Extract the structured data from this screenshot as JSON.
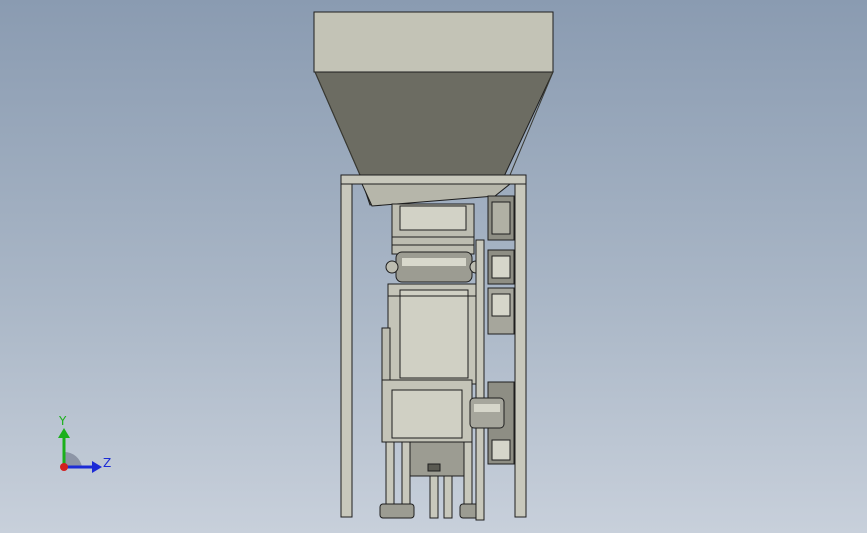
{
  "viewport": {
    "background_top": "#8a9bb1",
    "background_bottom": "#c8d0db"
  },
  "model": {
    "hopper_top_color": "#c3c3b6",
    "hopper_front_color": "#6c6c62",
    "frame_color": "#c8c8bc",
    "edge_color": "#1e1e1e"
  },
  "triad": {
    "y_label": "Y",
    "z_label": "Z",
    "y_color": "#1bb01b",
    "z_color": "#1c2bd6",
    "x_color": "#d21f1f"
  }
}
